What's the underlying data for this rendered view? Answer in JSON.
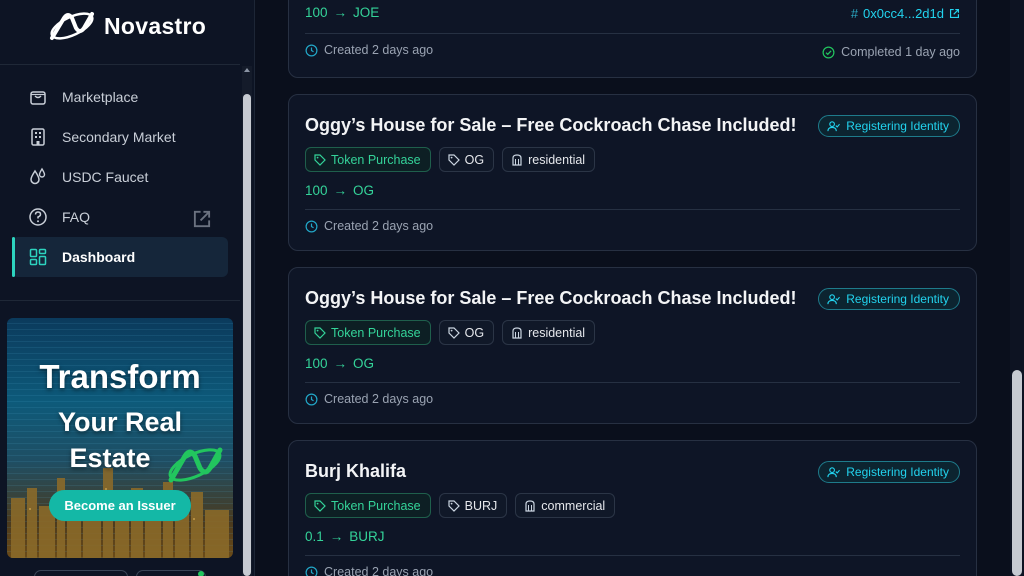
{
  "app": {
    "name": "Novastro"
  },
  "sidebar": {
    "items": [
      {
        "label": "Marketplace",
        "icon": "bag-icon"
      },
      {
        "label": "Secondary Market",
        "icon": "building-icon"
      },
      {
        "label": "USDC Faucet",
        "icon": "droplets-icon"
      },
      {
        "label": "FAQ",
        "icon": "help-circle-icon",
        "external": true
      },
      {
        "label": "Dashboard",
        "icon": "grid-icon",
        "active": true
      }
    ],
    "promo": {
      "title_line1": "Transform",
      "title_line2": "Your Real",
      "title_line3": "Estate",
      "button": "Become an Issuer"
    }
  },
  "top_card": {
    "amount": "100",
    "token": "JOE",
    "hash": "0x0cc4...2d1d",
    "created": "Created 2 days ago",
    "completed": "Completed 1 day ago"
  },
  "cards": [
    {
      "title": "Oggy’s House for Sale – Free Cockroach Chase Included!",
      "status": "Registering Identity",
      "tags": [
        "Token Purchase",
        "OG",
        "residential"
      ],
      "amount": "100",
      "token": "OG",
      "created": "Created 2 days ago"
    },
    {
      "title": "Oggy’s House for Sale – Free Cockroach Chase Included!",
      "status": "Registering Identity",
      "tags": [
        "Token Purchase",
        "OG",
        "residential"
      ],
      "amount": "100",
      "token": "OG",
      "created": "Created 2 days ago"
    },
    {
      "title": "Burj Khalifa",
      "status": "Registering Identity",
      "tags": [
        "Token Purchase",
        "BURJ",
        "commercial"
      ],
      "amount": "0.1",
      "token": "BURJ",
      "created": "Created 2 days ago"
    }
  ],
  "colors": {
    "accent": "#2dd4bf",
    "green": "#34d399",
    "cyan": "#22d3ee",
    "bg": "#0a0f1c"
  }
}
